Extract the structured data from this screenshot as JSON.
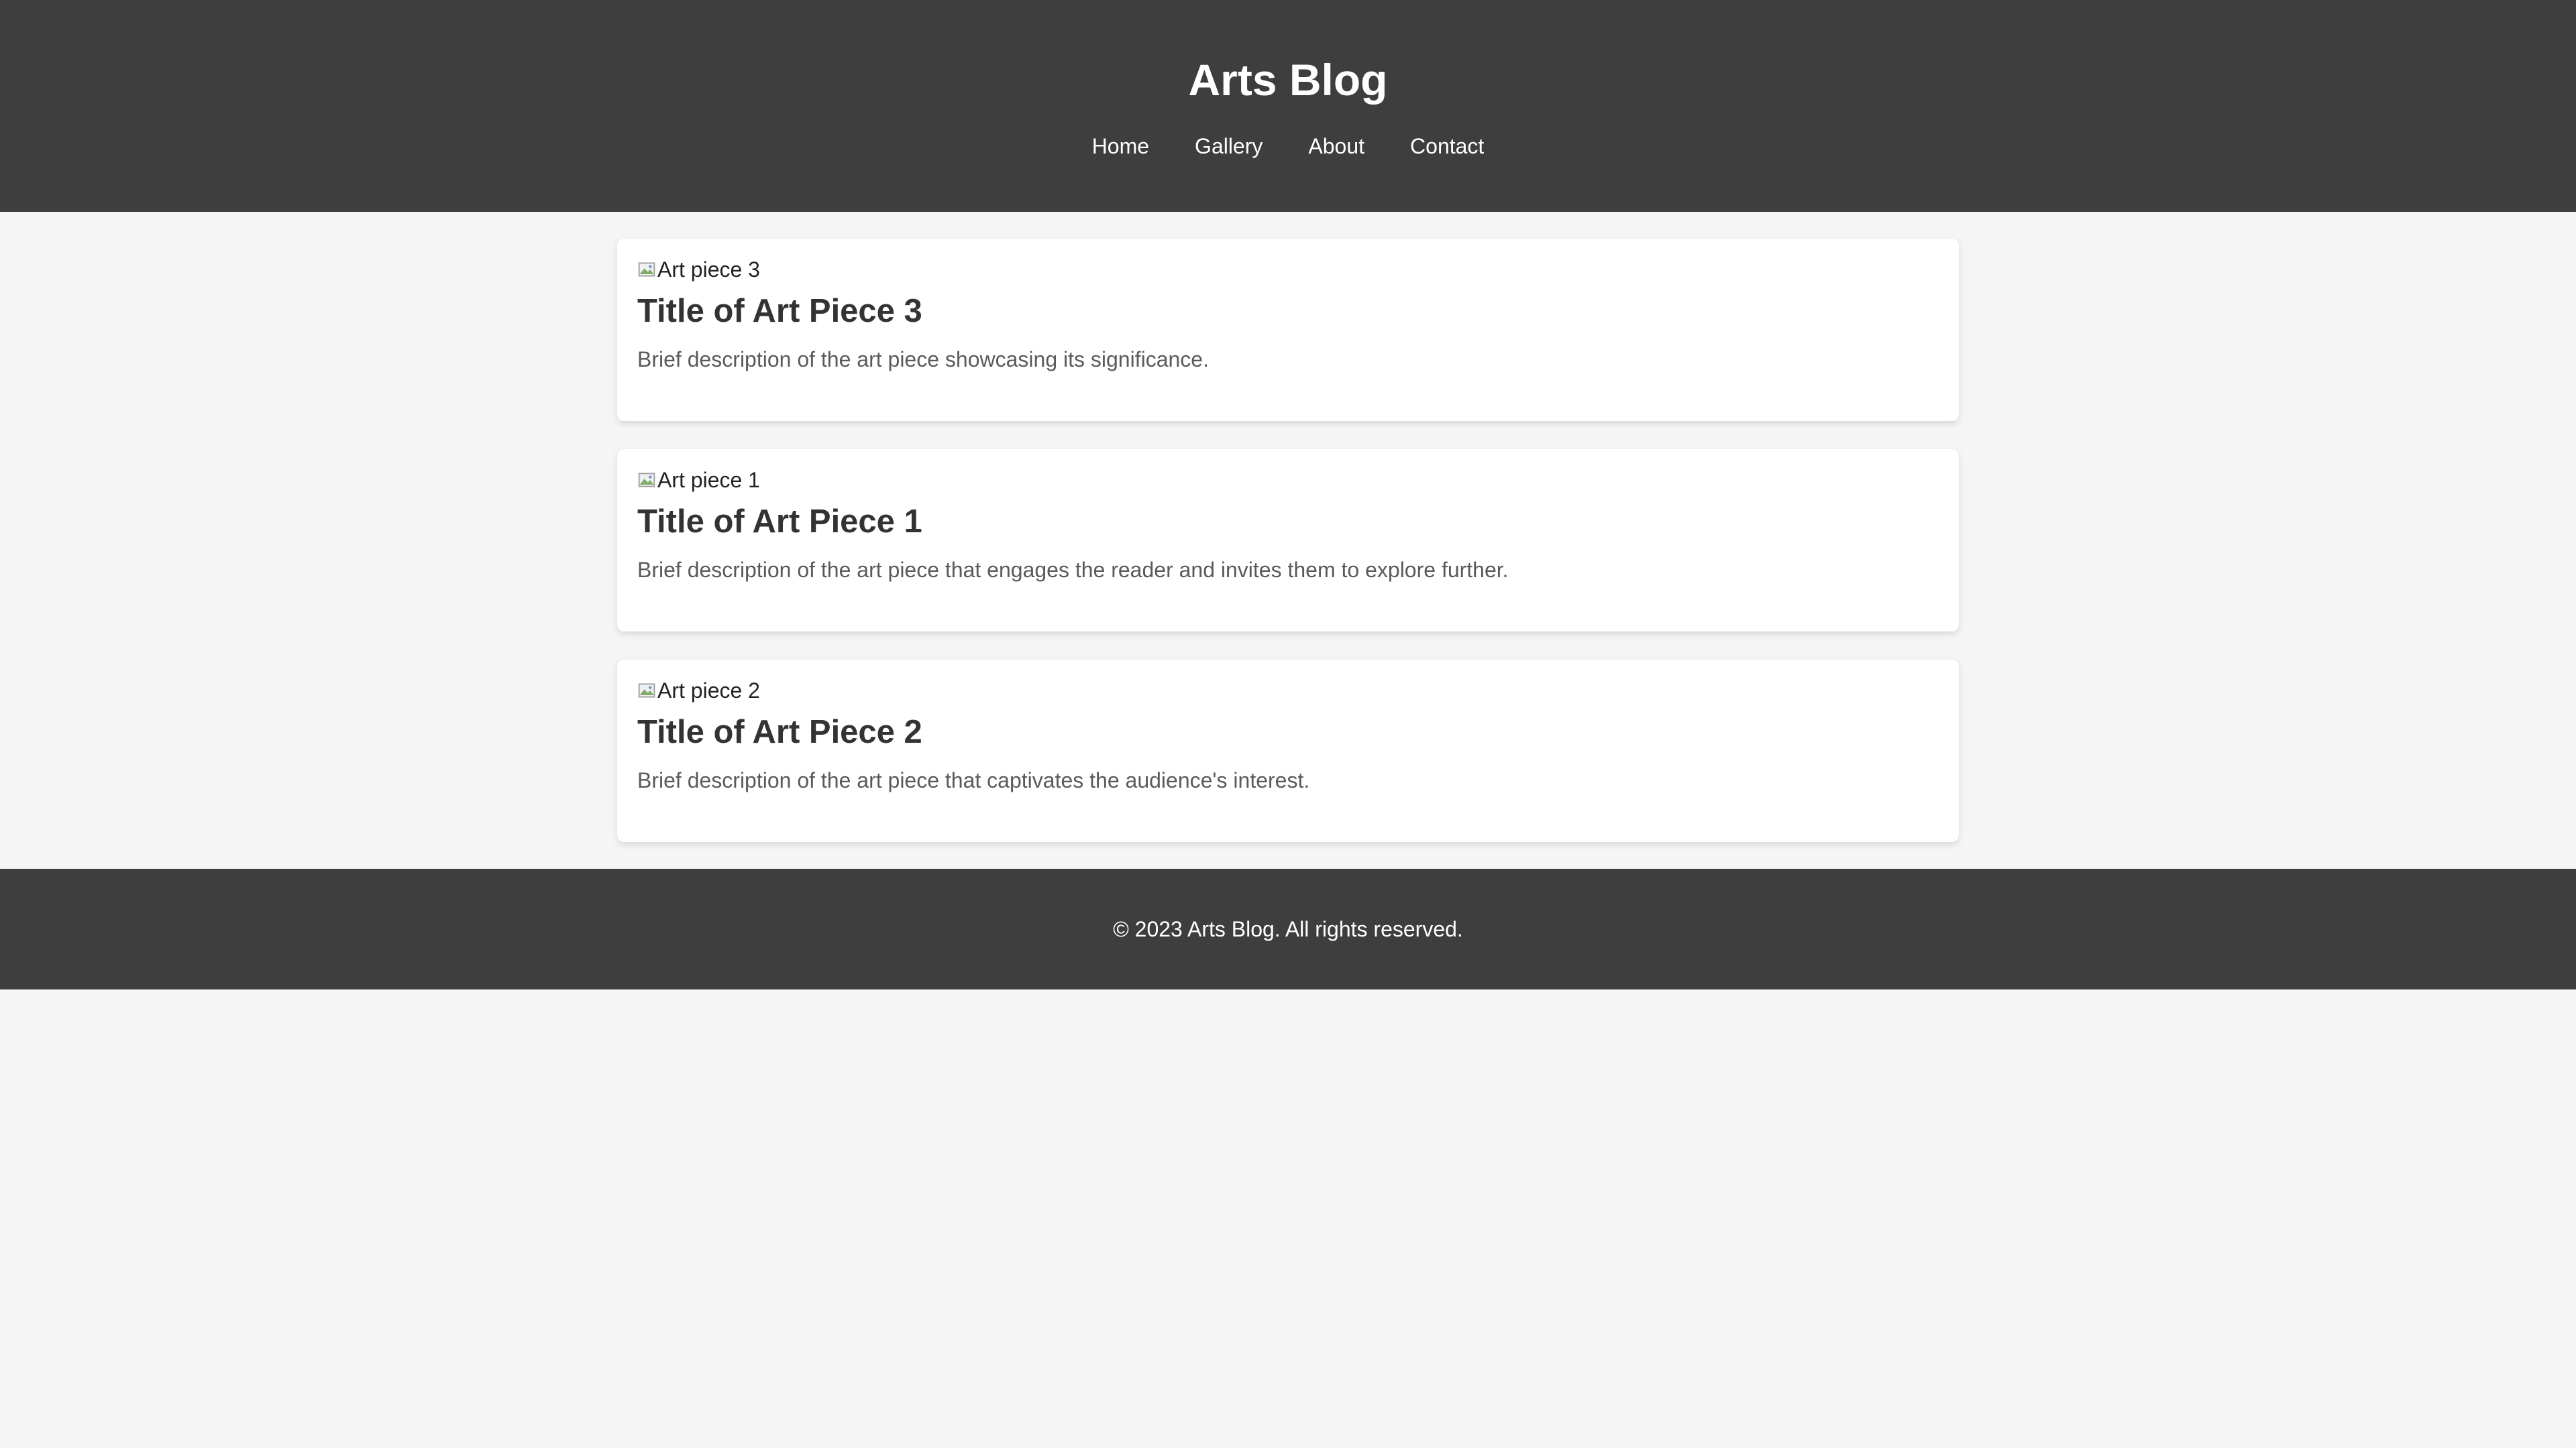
{
  "header": {
    "title": "Arts Blog",
    "nav": [
      {
        "label": "Home"
      },
      {
        "label": "Gallery"
      },
      {
        "label": "About"
      },
      {
        "label": "Contact"
      }
    ]
  },
  "posts": [
    {
      "image_alt": "Art piece 3",
      "title": "Title of Art Piece 3",
      "description": "Brief description of the art piece showcasing its significance."
    },
    {
      "image_alt": "Art piece 1",
      "title": "Title of Art Piece 1",
      "description": "Brief description of the art piece that engages the reader and invites them to explore further."
    },
    {
      "image_alt": "Art piece 2",
      "title": "Title of Art Piece 2",
      "description": "Brief description of the art piece that captivates the audience's interest."
    }
  ],
  "footer": {
    "text": "© 2023 Arts Blog. All rights reserved."
  },
  "colors": {
    "header_bg": "#3e3e3e",
    "page_bg": "#f5f5f5",
    "card_bg": "#ffffff",
    "title_text": "#333333",
    "description_text": "#5a5a5a"
  }
}
